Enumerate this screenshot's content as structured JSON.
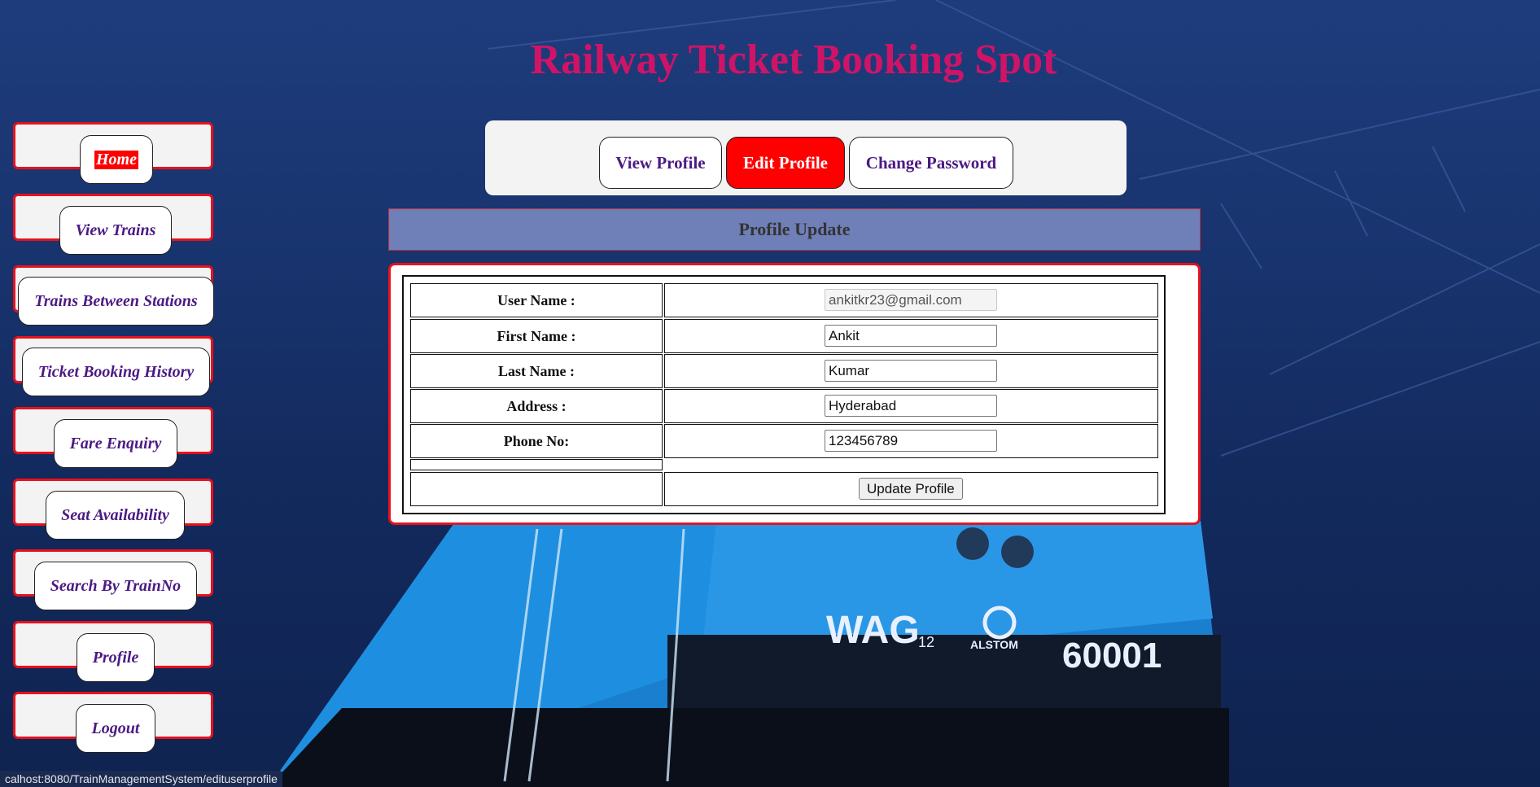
{
  "header": {
    "title": "Railway Ticket Booking Spot"
  },
  "sidebar": {
    "items": [
      {
        "label": "Home",
        "active": true
      },
      {
        "label": "View Trains"
      },
      {
        "label": "Trains Between Stations"
      },
      {
        "label": "Ticket Booking History"
      },
      {
        "label": "Fare Enquiry"
      },
      {
        "label": "Seat Availability"
      },
      {
        "label": "Search By TrainNo"
      },
      {
        "label": "Profile"
      },
      {
        "label": "Logout"
      }
    ]
  },
  "tabs": [
    {
      "label": "View Profile"
    },
    {
      "label": "Edit Profile",
      "active": true
    },
    {
      "label": "Change Password"
    }
  ],
  "section": {
    "title": "Profile Update"
  },
  "form": {
    "username_label": "User Name :",
    "username_value": "ankitkr23@gmail.com",
    "firstname_label": "First Name :",
    "firstname_value": "Ankit",
    "lastname_label": "Last Name :",
    "lastname_value": "Kumar",
    "address_label": "Address :",
    "address_value": "Hyderabad",
    "phone_label": "Phone No:",
    "phone_value": "123456789",
    "submit_label": "Update Profile"
  },
  "status_bar": {
    "url": "calhost:8080/TrainManagementSystem/edituserprofile"
  },
  "background": {
    "locomotive_text": [
      "WAG",
      "12",
      "ALSTOM",
      "60001"
    ]
  },
  "colors": {
    "title": "#cf1467",
    "accent_red": "#ff0000",
    "nav_text": "#4b1a84",
    "section_header": "#6f7fb8"
  }
}
